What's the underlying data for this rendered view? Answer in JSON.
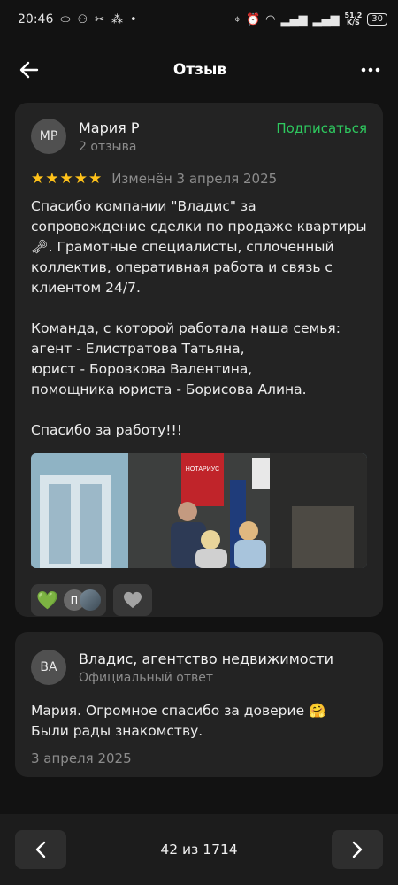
{
  "status_bar": {
    "time": "20:46",
    "net_speed_value": "51,2",
    "net_speed_unit": "K/S",
    "battery": "30"
  },
  "header": {
    "title": "Отзыв"
  },
  "review": {
    "avatar_initials": "МР",
    "author_name": "Мария Р",
    "author_reviews": "2 отзыва",
    "subscribe_label": "Подписаться",
    "rating": 5,
    "stars": "★★★★★",
    "edited": "Изменён 3 апреля 2025",
    "text": "Спасибо компании \"Владис\" за сопровождение сделки по продаже квартиры 🗝. Грамотные специалисты, сплоченный коллектив, оперативная работа и связь с клиентом 24/7.\n\nКоманда, с которой работала наша семья:\nагент - Елистратова Татьяна,\nюрист - Боровкова Валентина,\nпомощника юриста - Борисова Алина.\n\nСпасибо за работу!!!",
    "photo_sign": "НОТАРИУС",
    "reaction_avatar_initial": "П"
  },
  "reply": {
    "avatar_initials": "ВА",
    "author_name": "Владис, агентство недвижимости",
    "subtitle": "Официальный ответ",
    "text": "Мария. Огромное спасибо за доверие 🤗\nБыли рады знакомству.",
    "date": "3 апреля 2025"
  },
  "pager": {
    "counter": "42 из 1714"
  },
  "colors": {
    "accent_green": "#2ec95f",
    "star_yellow": "#ffc21a",
    "card_bg": "#232323",
    "page_bg": "#121212"
  }
}
